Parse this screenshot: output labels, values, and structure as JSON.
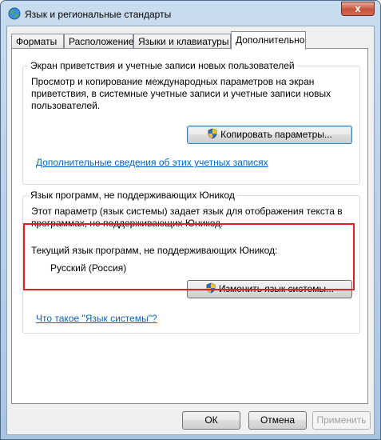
{
  "window": {
    "title": "Язык и региональные стандарты",
    "close_label": "x"
  },
  "tabs": [
    {
      "label": "Форматы"
    },
    {
      "label": "Расположение"
    },
    {
      "label": "Языки и клавиатуры"
    },
    {
      "label": "Дополнительно"
    }
  ],
  "welcome_group": {
    "title": "Экран приветствия и учетные записи новых пользователей",
    "description": "Просмотр и копирование международных параметров на экран приветствия, в системные учетные записи и учетные записи новых пользователей.",
    "copy_button": "Копировать параметры...",
    "link": "Дополнительные сведения об этих учетных записях"
  },
  "unicode_group": {
    "title": "Язык программ, не поддерживающих Юникод",
    "description": "Этот параметр (язык системы) задает язык для отображения текста в программах, не поддерживающих Юникод.",
    "current_label": "Текущий язык программ, не поддерживающих Юникод:",
    "current_value": "Русский (Россия)",
    "change_button": "Изменить язык системы...",
    "link": "Что такое \"Язык системы\"?"
  },
  "footer": {
    "ok": "ОК",
    "cancel": "Отмена",
    "apply": "Применить"
  },
  "colors": {
    "highlight": "#e02020",
    "link": "#0066cc"
  }
}
